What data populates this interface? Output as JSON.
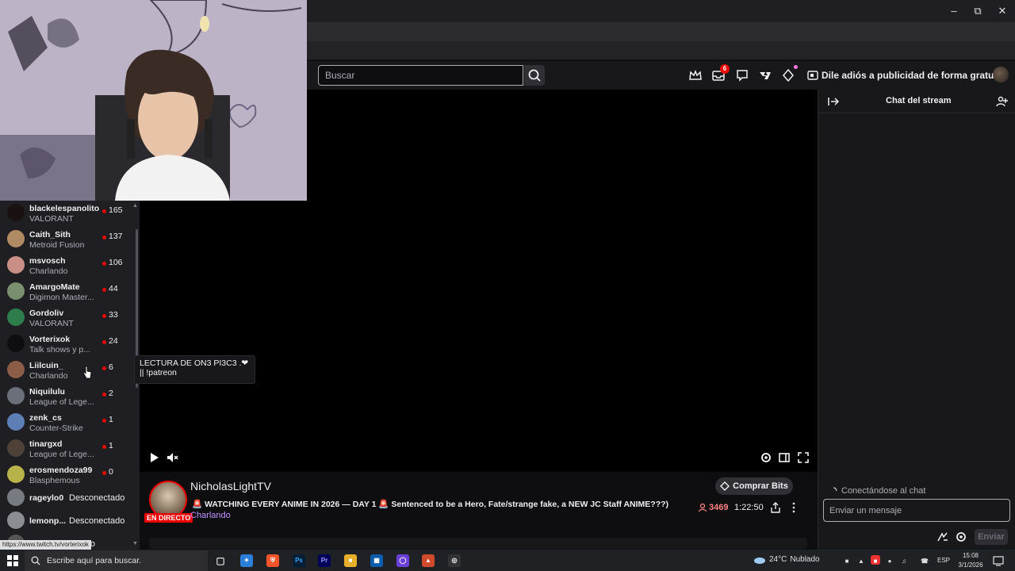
{
  "browser": {
    "toolbar_icons": [
      "zoom-icon",
      "share-icon",
      "brave-shield-icon",
      "rewards-icon",
      "extensions-icon",
      "tab-search-icon",
      "media-icon",
      "sidebar-icon",
      "wallet-icon",
      "leo-icon",
      "vpn-icon",
      "menu-icon"
    ],
    "window_buttons": [
      "minimize",
      "restore",
      "close"
    ]
  },
  "topnav": {
    "search_placeholder": "Buscar",
    "notifications_count": "6",
    "ad_free_label": "Dile adiós a publicidad de forma gratuita"
  },
  "sidebar": {
    "channels": [
      {
        "name": "blackelespanolito",
        "game": "VALORANT",
        "viewers": "165",
        "live": true,
        "avatar_color": "#1a1113"
      },
      {
        "name": "Caith_Sith",
        "game": "Metroid Fusion",
        "viewers": "137",
        "live": true,
        "avatar_color": "#b08a63"
      },
      {
        "name": "msvosch",
        "game": "Charlando",
        "viewers": "106",
        "live": true,
        "avatar_color": "#c98f86"
      },
      {
        "name": "AmargoMate",
        "game": "Digimon Master...",
        "viewers": "44",
        "live": true,
        "avatar_color": "#7a8f6e"
      },
      {
        "name": "Gordoliv",
        "game": "VALORANT",
        "viewers": "33",
        "live": true,
        "avatar_color": "#2e7d4a"
      },
      {
        "name": "Vorterixok",
        "game": "Talk shows y p...",
        "viewers": "24",
        "live": true,
        "avatar_color": "#0e0e10"
      },
      {
        "name": "Liilcuin_",
        "game": "Charlando",
        "viewers": "6",
        "live": true,
        "avatar_color": "#8b5c46"
      },
      {
        "name": "Niquilulu",
        "game": "League of Lege...",
        "viewers": "2",
        "live": true,
        "avatar_color": "#6b6f7a"
      },
      {
        "name": "zenk_cs",
        "game": "Counter-Strike",
        "viewers": "1",
        "live": true,
        "avatar_color": "#5d7fb5"
      },
      {
        "name": "tinargxd",
        "game": "League of Lege...",
        "viewers": "1",
        "live": true,
        "avatar_color": "#4e4238"
      },
      {
        "name": "erosmendoza99",
        "game": "Blasphemous",
        "viewers": "0",
        "live": true,
        "avatar_color": "#b7b34a"
      },
      {
        "name": "rageylo0",
        "status": "Desconectado",
        "live": false,
        "avatar_color": "#777a80"
      },
      {
        "name": "lemonp...",
        "status": "Desconectado",
        "live": false,
        "avatar_color": "#8a8d92"
      },
      {
        "name": "",
        "status": "ectado",
        "live": false,
        "avatar_color": "#555"
      }
    ]
  },
  "video": {
    "tooltip_line1": "LECTURA DE ON3 PI3C3 .❤",
    "tooltip_line2": "|| !patreon"
  },
  "stream": {
    "streamer": "NicholasLightTV",
    "live_badge": "EN DIRECTO",
    "title": "🚨 WATCHING EVERY ANIME IN 2026 — DAY 1 🚨 Sentenced to be a Hero, Fate/strange fake, a NEW JC Staff ANIME???)",
    "category": "Charlando",
    "buy_bits_label": "Comprar Bits",
    "viewers": "3469",
    "uptime": "1:22:50"
  },
  "chat": {
    "title": "Chat del stream",
    "connecting": "Conectándose al chat",
    "input_placeholder": "Enviar un mensaje",
    "send_label": "Enviar"
  },
  "status_url": "https://www.twitch.tv/vorterixok",
  "taskbar": {
    "search_placeholder": "Escribe aquí para buscar.",
    "weather_temp": "24°C",
    "weather_desc": "Nublado",
    "lang": "ESP",
    "time": "15:08",
    "date": "3/1/2026"
  },
  "colors": {
    "twitch_purple": "#9147ff",
    "live_red": "#eb0400",
    "bg_dark": "#0e0e10"
  }
}
